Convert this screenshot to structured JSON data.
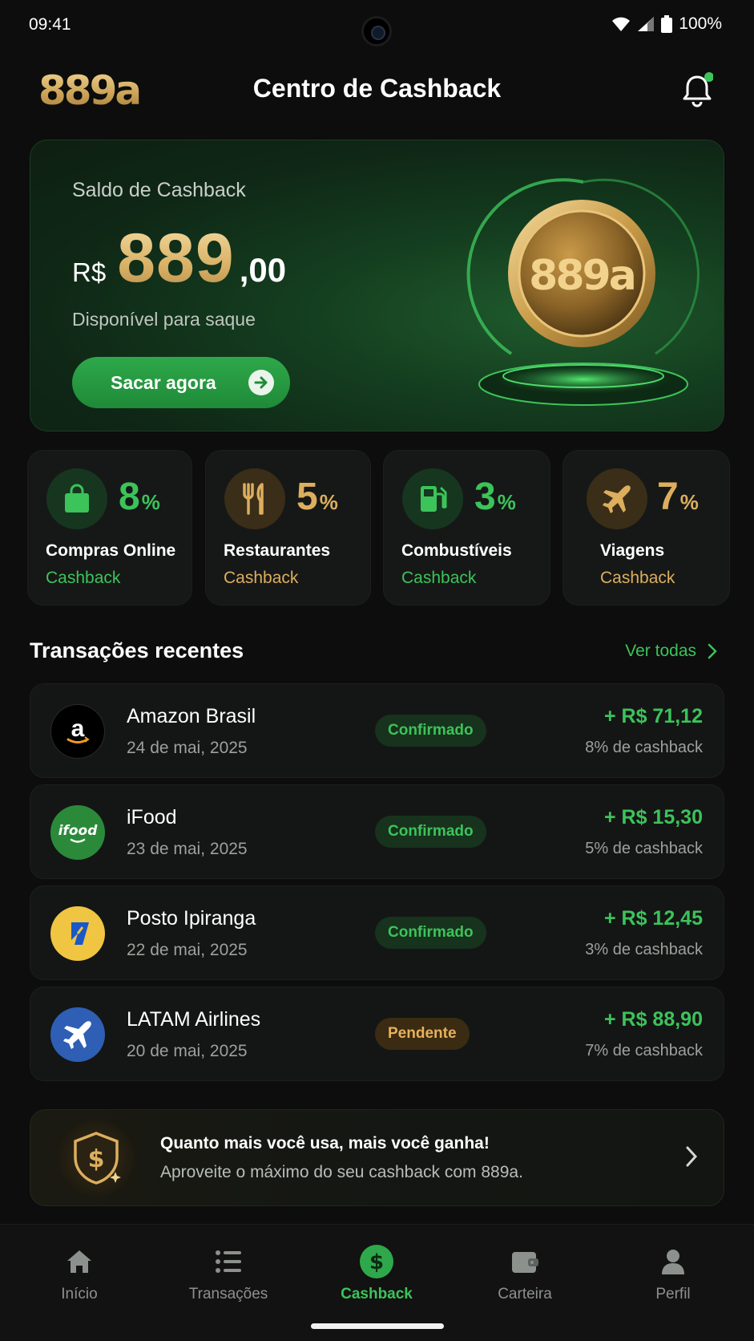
{
  "status_bar": {
    "time": "09:41",
    "battery": "100%"
  },
  "header": {
    "logo": "889a",
    "title": "Centro de Cashback"
  },
  "balance": {
    "label": "Saldo de Cashback",
    "currency": "R$",
    "integer": "889",
    "decimal": ",00",
    "subtitle": "Disponível para saque",
    "withdraw_label": "Sacar agora",
    "coin_text": "889a"
  },
  "categories": [
    {
      "percent": "8",
      "sign": "%",
      "name": "Compras Online",
      "sub": "Cashback",
      "icon": "shopping-bag-icon",
      "accent": "#3cc35a"
    },
    {
      "percent": "5",
      "sign": "%",
      "name": "Restaurantes",
      "sub": "Cashback",
      "icon": "fork-knife-icon",
      "accent": "#dcae5e"
    },
    {
      "percent": "3",
      "sign": "%",
      "name": "Combustíveis",
      "sub": "Cashback",
      "icon": "fuel-pump-icon",
      "accent": "#3cc35a"
    },
    {
      "percent": "7",
      "sign": "%",
      "name": "Viagens",
      "sub": "Cashback",
      "icon": "airplane-icon",
      "accent": "#dcae5e"
    }
  ],
  "transactions": {
    "title": "Transações recentes",
    "see_all": "Ver todas",
    "items": [
      {
        "merchant": "Amazon Brasil",
        "date": "24 de mai, 2025",
        "status": "Confirmado",
        "amount": "+ R$ 71,12",
        "rate": "8% de cashback",
        "logo_text": "a"
      },
      {
        "merchant": "iFood",
        "date": "23 de mai, 2025",
        "status": "Confirmado",
        "amount": "+ R$ 15,30",
        "rate": "5% de cashback",
        "logo_text": "ifood"
      },
      {
        "merchant": "Posto Ipiranga",
        "date": "22 de mai, 2025",
        "status": "Confirmado",
        "amount": "+ R$ 12,45",
        "rate": "3% de cashback",
        "logo_text": ""
      },
      {
        "merchant": "LATAM Airlines",
        "date": "20 de mai, 2025",
        "status": "Pendente",
        "amount": "+ R$ 88,90",
        "rate": "7% de cashback",
        "logo_text": ""
      }
    ]
  },
  "promo": {
    "title": "Quanto mais você usa, mais você ganha!",
    "subtitle": "Aproveite o máximo do seu cashback com 889a.",
    "shield_symbol": "$"
  },
  "bottom_nav": [
    {
      "label": "Início",
      "icon": "home-icon"
    },
    {
      "label": "Transações",
      "icon": "list-icon"
    },
    {
      "label": "Cashback",
      "icon": "dollar-coin-icon",
      "active": true
    },
    {
      "label": "Carteira",
      "icon": "wallet-icon"
    },
    {
      "label": "Perfil",
      "icon": "user-icon"
    }
  ],
  "colors": {
    "green": "#3cc35a",
    "gold": "#dcae5e",
    "background": "#0c0d0c"
  }
}
